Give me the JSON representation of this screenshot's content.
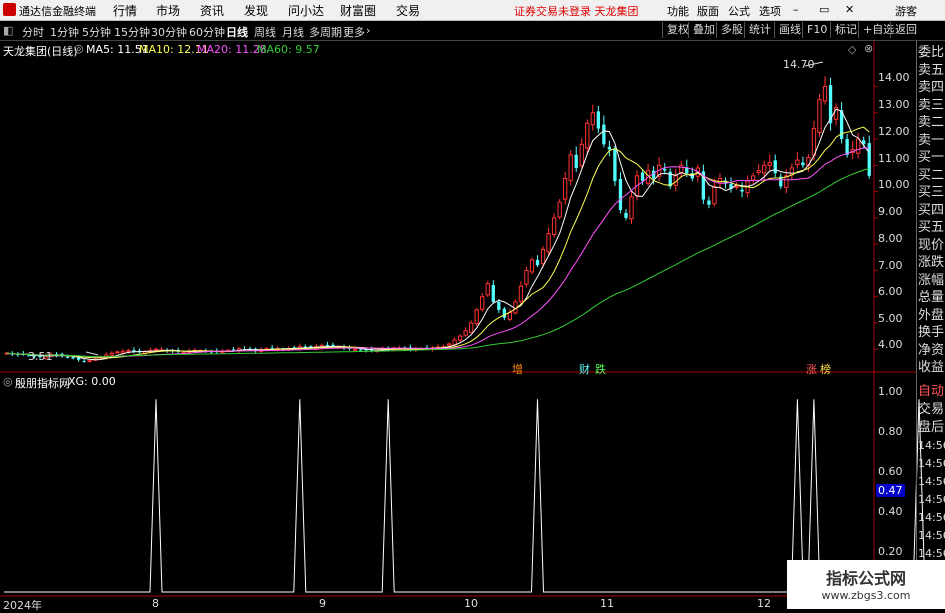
{
  "menubar": {
    "app_title": "通达信金融终端",
    "menus": [
      "行情",
      "市场",
      "资讯",
      "发现",
      "问小达",
      "财富圈",
      "交易"
    ],
    "warning": "证券交易未登录  天龙集团",
    "right": [
      "功能",
      "版面",
      "公式",
      "选项"
    ],
    "user": "游客",
    "window_controls": [
      "minimize-icon",
      "restore-icon",
      "close-icon"
    ]
  },
  "periods": [
    "分时",
    "1分钟",
    "5分钟",
    "15分钟",
    "30分钟",
    "60分钟",
    "日线",
    "周线",
    "月线",
    "多周期",
    "更多"
  ],
  "period_active": "日线",
  "toolbar_right": [
    "复权",
    "叠加",
    "多股",
    "统计",
    "画线",
    "F10",
    "标记",
    "+自选",
    "返回"
  ],
  "stock": {
    "title": "天龙集团(日线)",
    "ma5": "MA5: 11.51",
    "ma10": "MA10: 12.11",
    "ma20": "MA20: 11.28",
    "ma60": "MA60: 9.57",
    "high_label": "14.70",
    "low_label": "3.51"
  },
  "colors": {
    "up": "#ff3232",
    "down": "#54ffff",
    "ma5": "#ffffff",
    "ma10": "#ffff55",
    "ma20": "#ff55ff",
    "ma60": "#33cc33",
    "indicator": "#ffffff"
  },
  "yaxis_main": [
    "14.00",
    "13.00",
    "12.00",
    "11.00",
    "10.00",
    "9.00",
    "8.00",
    "7.00",
    "6.00",
    "5.00",
    "4.00"
  ],
  "yaxis_ind": [
    "1.00",
    "0.80",
    "0.60",
    "0.47",
    "0.40",
    "0.20"
  ],
  "side_panel": [
    "委比",
    "卖五",
    "卖四",
    "卖三",
    "卖二",
    "卖一",
    "买一",
    "买二",
    "买三",
    "买四",
    "买五",
    "现价",
    "涨跌",
    "涨幅",
    "总量",
    "外盘",
    "换手",
    "净资",
    "收益"
  ],
  "side_panel_lower": [
    "自动",
    "交易",
    "盘后",
    "14:56",
    "14:56",
    "14:56",
    "14:56",
    "14:56",
    "14:56",
    "14:56",
    "14:56",
    "14:56"
  ],
  "events": [
    "增",
    "财",
    "跌",
    "涨",
    "榜"
  ],
  "indicator": {
    "name": "殷朋指标网",
    "value": "XG: 0.00"
  },
  "xaxis": [
    "2024年",
    "8",
    "9",
    "10",
    "11",
    "12"
  ],
  "watermark": {
    "line1": "指标公式网",
    "line2": "www.zbgs3.com"
  },
  "chart_data": [
    {
      "type": "candlestick",
      "title": "天龙集团(日线)",
      "ylim": [
        3.4,
        15.2
      ],
      "series": [
        {
          "name": "MA5",
          "value": 11.51
        },
        {
          "name": "MA10",
          "value": 12.11
        },
        {
          "name": "MA20",
          "value": 11.28
        },
        {
          "name": "MA60",
          "value": 9.57
        }
      ],
      "close": [
        3.85,
        3.82,
        3.78,
        3.8,
        3.76,
        3.72,
        3.7,
        3.75,
        3.8,
        3.78,
        3.74,
        3.7,
        3.65,
        3.6,
        3.55,
        3.58,
        3.62,
        3.7,
        3.78,
        3.85,
        3.9,
        3.92,
        3.95,
        3.9,
        3.88,
        3.92,
        3.96,
        4.0,
        3.98,
        3.95,
        3.92,
        3.9,
        3.88,
        3.92,
        3.96,
        3.95,
        3.9,
        3.88,
        3.9,
        3.93,
        3.96,
        3.98,
        4.02,
        4.0,
        3.97,
        3.95,
        3.98,
        4.02,
        4.05,
        4.03,
        4.0,
        4.02,
        4.06,
        4.1,
        4.08,
        4.05,
        4.1,
        4.15,
        4.12,
        4.1,
        4.08,
        4.05,
        4.02,
        4.0,
        3.98,
        3.96,
        3.95,
        3.97,
        4.0,
        4.03,
        4.05,
        4.04,
        4.02,
        4.0,
        4.01,
        4.03,
        4.05,
        4.06,
        4.08,
        4.1,
        4.2,
        4.35,
        4.5,
        4.7,
        5.0,
        5.5,
        6.0,
        6.5,
        5.8,
        5.5,
        5.2,
        5.4,
        5.8,
        6.4,
        7.0,
        7.4,
        7.2,
        7.8,
        8.4,
        9.0,
        9.6,
        10.5,
        11.4,
        10.9,
        11.8,
        12.6,
        13.0,
        12.4,
        11.8,
        11.6,
        10.4,
        9.3,
        9.0,
        9.8,
        10.6,
        10.4,
        10.8,
        10.5,
        11.0,
        10.8,
        10.2,
        10.6,
        11.0,
        10.7,
        10.5,
        10.9,
        9.7,
        9.5,
        10.2,
        10.5,
        10.3,
        10.1,
        10.2,
        10.0,
        10.4,
        10.6,
        10.8,
        11.0,
        11.1,
        10.7,
        10.2,
        10.6,
        10.9,
        11.2,
        11.0,
        11.3,
        12.4,
        13.5,
        14.0,
        12.6,
        13.2,
        12.0,
        11.4,
        11.6,
        12.0,
        11.8,
        10.6
      ]
    },
    {
      "type": "line",
      "name": "XG",
      "value": 0.0,
      "ylim": [
        0,
        1.1
      ],
      "signal_bars": [
        27,
        53,
        69,
        96,
        143,
        146,
        165,
        176
      ],
      "signal_value": 1.0
    }
  ]
}
